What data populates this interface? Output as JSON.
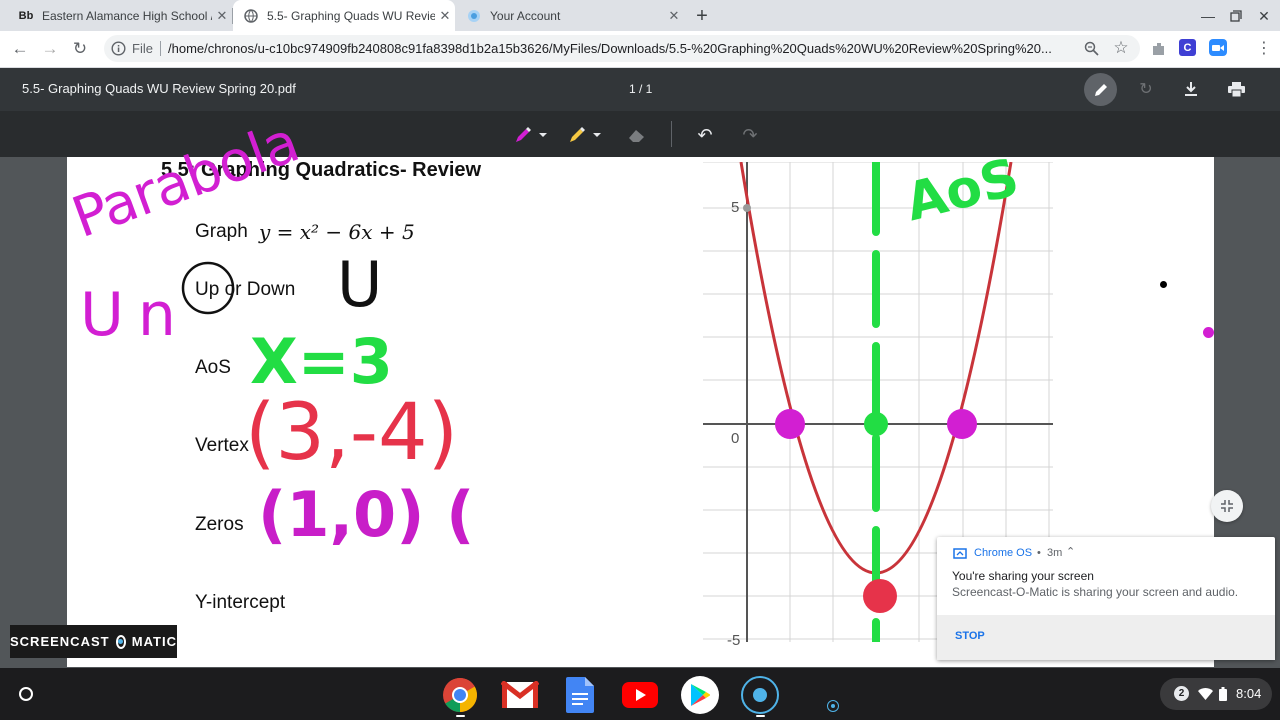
{
  "browser": {
    "tabs": [
      {
        "favicon": "Bb",
        "title": "Eastern Alamance High School / …"
      },
      {
        "favicon": "globe-icon",
        "title": "5.5- Graphing Quads WU Review …"
      },
      {
        "favicon": "account-icon",
        "title": "Your Account"
      }
    ],
    "file_label": "File",
    "url": "/home/chronos/u-c10bc974909fb240808c91fa8398d1b2a15b3626/MyFiles/Downloads/5.5-%20Graphing%20Quads%20WU%20Review%20Spring%20..."
  },
  "pdf_viewer": {
    "title": "5.5- Graphing Quads WU Review Spring 20.pdf",
    "page_indicator": "1 / 1"
  },
  "document": {
    "heading": "5.5: Graphing Quadratics- Review",
    "graph_prefix": "Graph",
    "equation": "y = x² − 6x + 5",
    "labels": {
      "up_down": "Up or Down",
      "aos": "AoS",
      "vertex": "Vertex",
      "zeros": "Zeros",
      "y_intercept": "Y-intercept"
    },
    "handwriting": {
      "parabola": "Parabola",
      "un": "Un",
      "u_shape": "U",
      "aos_answer": "X=3",
      "vertex_answer": "(3,-4)",
      "zeros_answer": "(1,0) (",
      "aos_graph_label": "AoS"
    }
  },
  "graph": {
    "tick_5": "5",
    "tick_0": "0",
    "tick_neg5": "-5"
  },
  "notification": {
    "source": "Chrome OS",
    "age": "3m",
    "title": "You're sharing your screen",
    "body": "Screencast-O-Matic is sharing your screen and audio.",
    "stop_label": "STOP"
  },
  "watermark": {
    "text_left": "SCREENCAST",
    "text_right": "MATIC"
  },
  "status_tray": {
    "notification_count": "2",
    "time": "8:04"
  },
  "colors": {
    "magenta_ink": "#d21fd2",
    "green_ink": "#22dd44",
    "red_ink": "#e6334a",
    "curve": "#c8343a"
  }
}
